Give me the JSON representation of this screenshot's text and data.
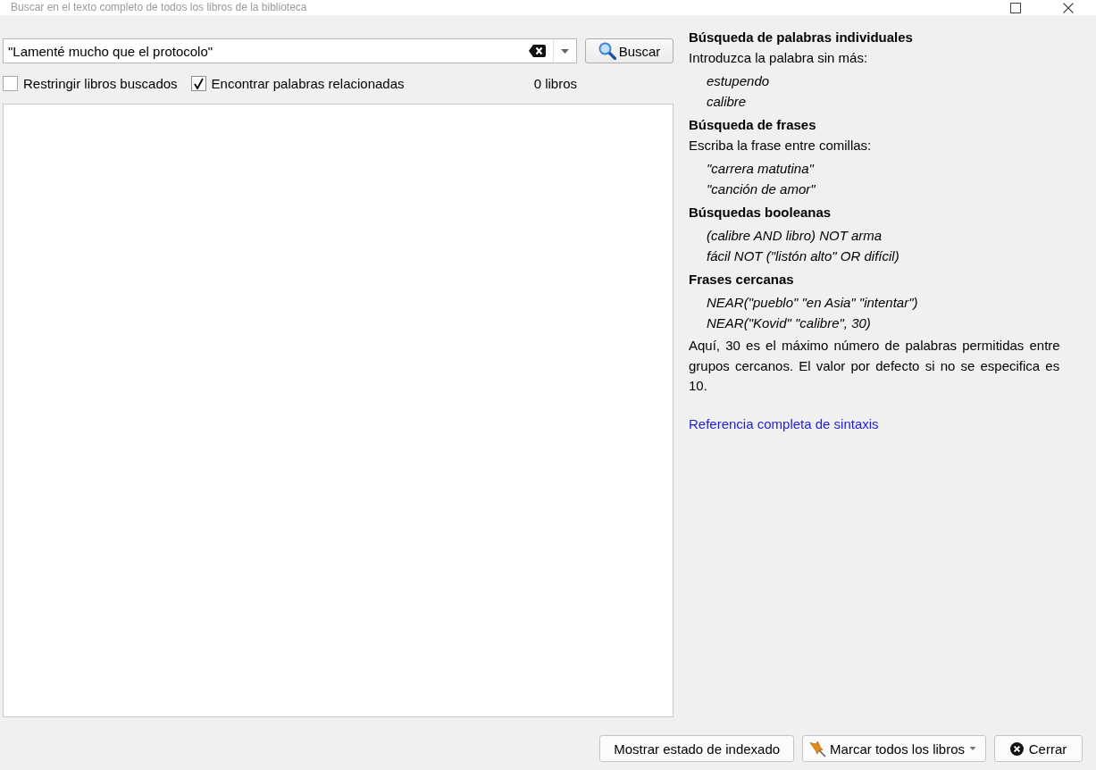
{
  "window": {
    "title": "Buscar en el texto completo de todos los libros de la biblioteca",
    "controls": [
      {
        "kind": "maximize"
      },
      {
        "kind": "close"
      }
    ]
  },
  "search": {
    "value": "\"Lamenté mucho que el protocolo\"",
    "button": "Buscar"
  },
  "options": [
    {
      "label": "Restringir libros buscados",
      "checked": false
    },
    {
      "label": "Encontrar palabras relacionadas",
      "checked": true
    }
  ],
  "result_count": "0 libros",
  "help": {
    "sections": [
      {
        "heading": "Búsqueda de palabras individuales",
        "intro": "Introduzca la palabra sin más:",
        "examples": [
          "estupendo",
          "calibre"
        ]
      },
      {
        "heading": "Búsqueda de frases",
        "intro": "Escriba la frase entre comillas:",
        "examples": [
          "\"carrera matutina\"",
          "\"canción de amor\""
        ]
      },
      {
        "heading": "Búsquedas booleanas",
        "examples": [
          "(calibre AND libro) NOT arma",
          "fácil NOT (\"listón alto\" OR difícil)"
        ]
      },
      {
        "heading": "Frases cercanas",
        "examples": [
          "NEAR(\"pueblo\" \"en Asia\" \"intentar\")",
          "NEAR(\"Kovid\" \"calibre\", 30)"
        ]
      }
    ],
    "note": "Aquí, 30 es el máximo número de palabras permitidas entre grupos cercanos. El valor por defecto si no se especifica es 10.",
    "link": "Referencia completa de sintaxis"
  },
  "footer_buttons": [
    {
      "label": "Mostrar estado de indexado",
      "kind": "plain"
    },
    {
      "label": "Marcar todos los libros",
      "kind": "menu"
    },
    {
      "label": "Cerrar",
      "kind": "close"
    }
  ]
}
